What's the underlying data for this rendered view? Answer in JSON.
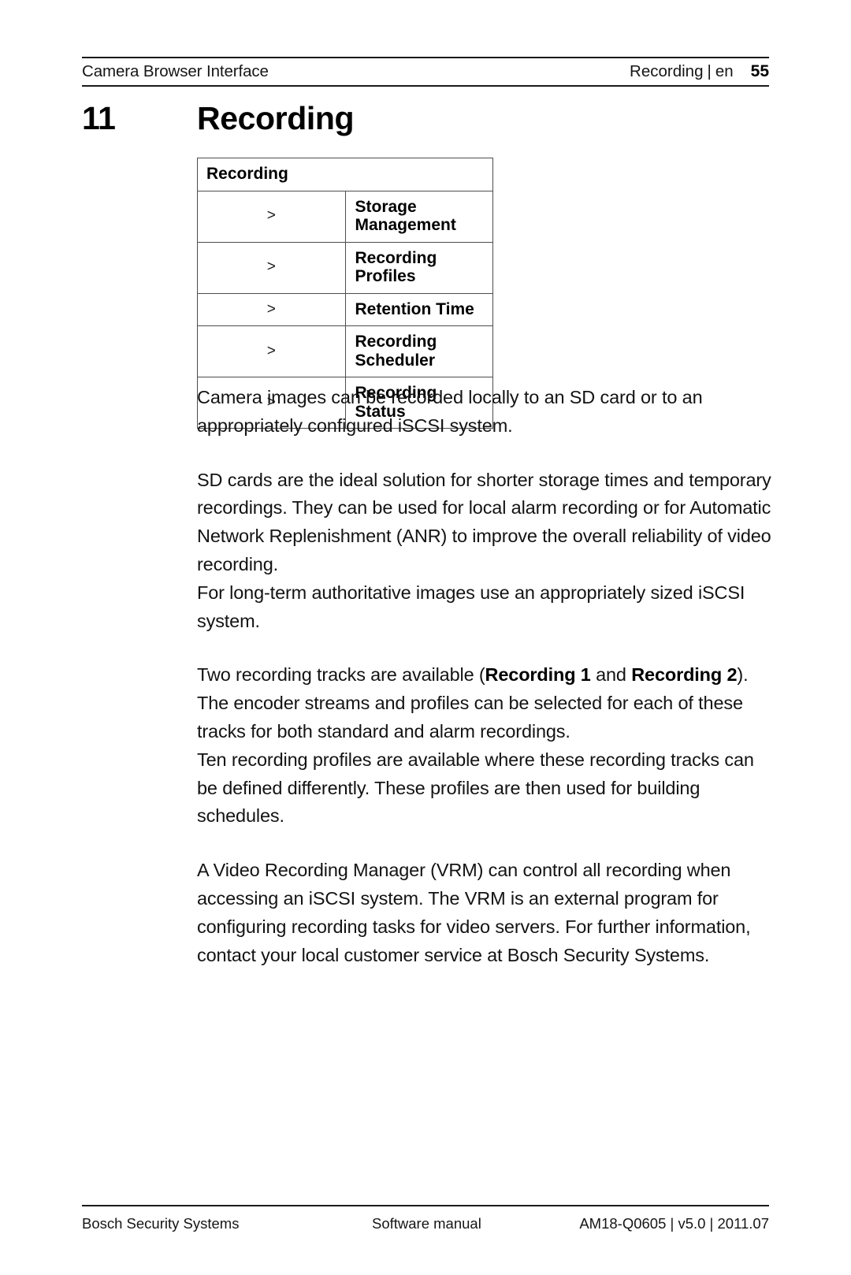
{
  "document": {
    "page_number": "55",
    "background_color": "#ffffff",
    "text_color": "#131313",
    "rule_color": "#1a1a1a"
  },
  "header": {
    "left": "Camera Browser Interface",
    "chapter": "Recording",
    "separator": "|",
    "language": "en",
    "page_number": "55"
  },
  "chapter": {
    "number": "11",
    "title": "Recording"
  },
  "nav_table": {
    "header": "Recording",
    "arrow_glyph": ">",
    "rows": [
      {
        "arrow": ">",
        "label": "Storage Management"
      },
      {
        "arrow": ">",
        "label": "Recording Profiles"
      },
      {
        "arrow": ">",
        "label": "Retention Time"
      },
      {
        "arrow": ">",
        "label": "Recording Scheduler"
      },
      {
        "arrow": ">",
        "label": "Recording Status"
      }
    ]
  },
  "body": {
    "paragraph_1": "Camera images can be recorded locally to an SD card or to an appropriately configured iSCSI system.",
    "paragraph_2": "SD cards are the ideal solution for shorter storage times and temporary recordings. They can be used for local alarm recording or for Automatic Network Replenishment (ANR) to improve the overall reliability of video recording.\nFor long-term authoritative images use an appropriately sized iSCSI system.",
    "paragraph_3": {
      "part_1": "Two recording tracks are available (",
      "bold_1": "Recording 1",
      "part_2": " and ",
      "bold_2": "Recording 2",
      "part_3": "). The encoder streams and profiles can be selected for each of these tracks for both standard and alarm recordings.\nTen recording profiles are available where these recording tracks can be defined differently. These profiles are then used for building schedules."
    },
    "paragraph_4": "A Video Recording Manager (VRM) can control all recording when accessing an iSCSI system. The VRM is an external program for configuring recording tasks for video servers. For further information, contact your local customer service at Bosch Security Systems."
  },
  "footer": {
    "left": "Bosch Security Systems",
    "center": "Software manual",
    "right": "AM18-Q0605 | v5.0 | 2011.07"
  }
}
